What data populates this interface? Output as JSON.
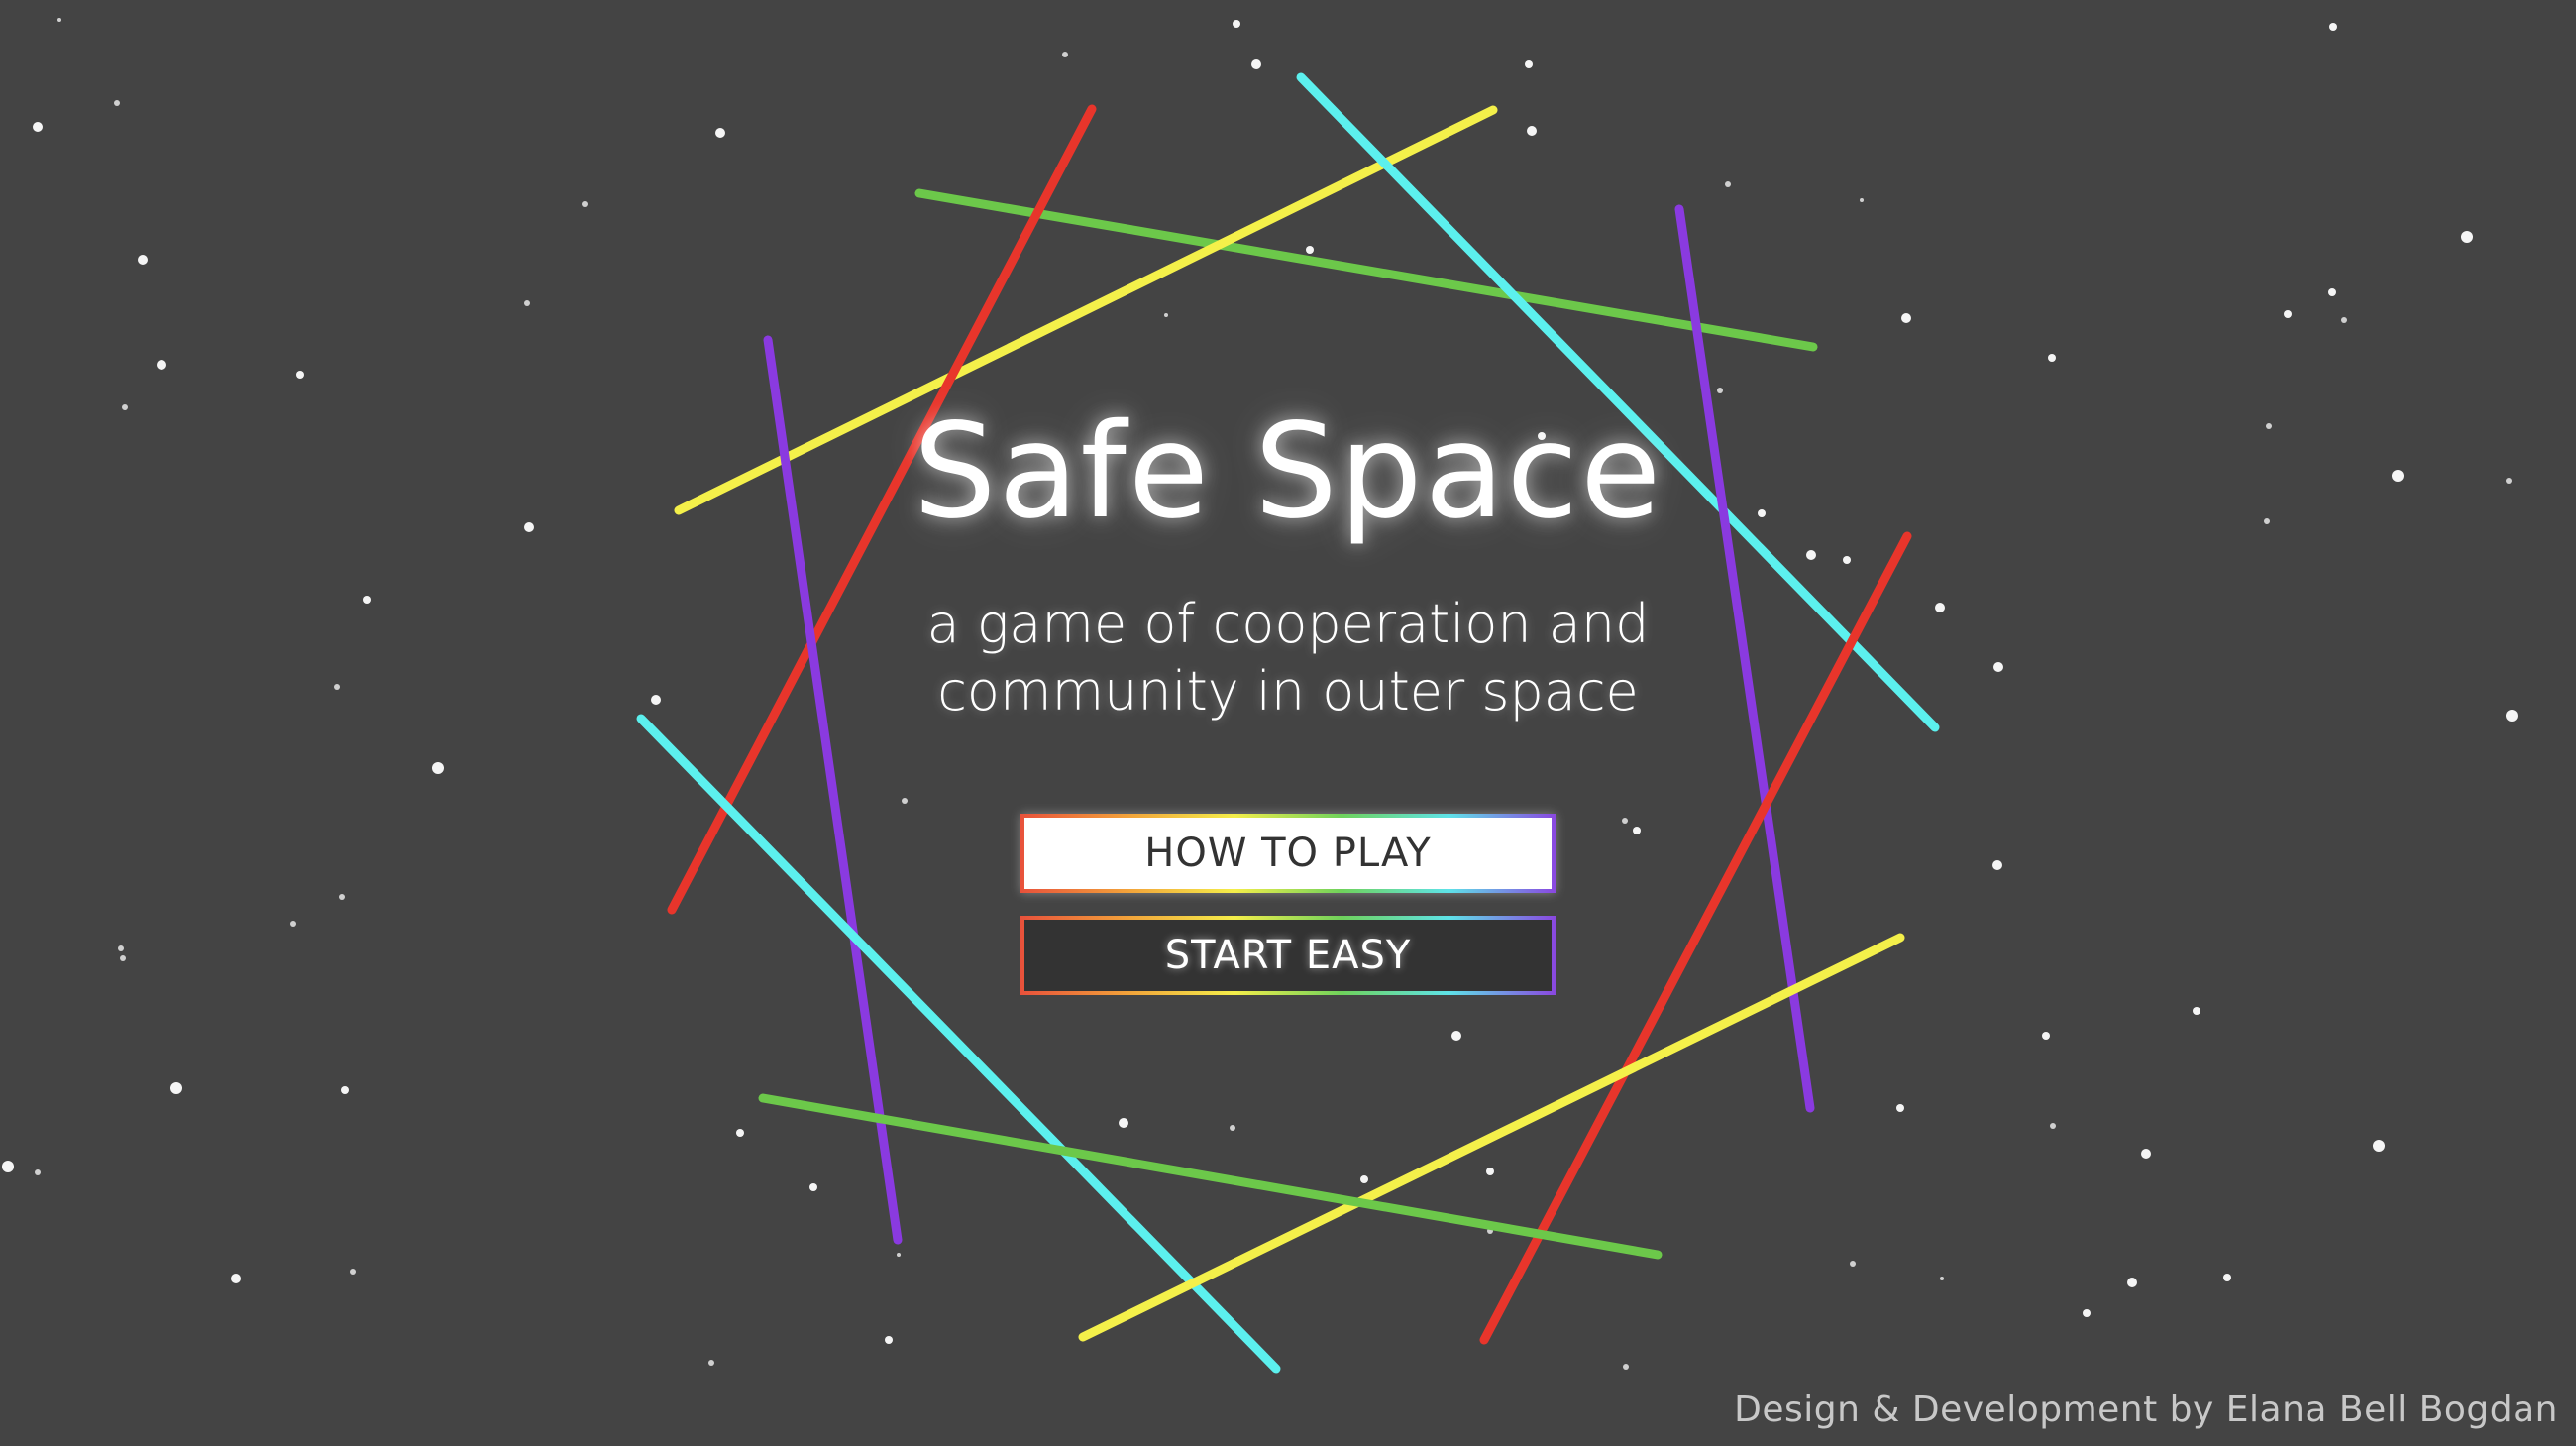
{
  "game": {
    "title": "Safe Space",
    "subtitle_line1": "a game of cooperation and",
    "subtitle_line2": "community in outer space",
    "background_color": "#444444"
  },
  "menu": {
    "how_to_play_label": "HOW TO PLAY",
    "start_label": "START EASY"
  },
  "footer": {
    "credit": "Design & Development by Elana Bell Bogdan"
  },
  "palette": {
    "red": "#e8352b",
    "yellow": "#f4f04a",
    "green": "#6cc84a",
    "cyan": "#5cf0ee",
    "purple": "#8a3ae0"
  }
}
